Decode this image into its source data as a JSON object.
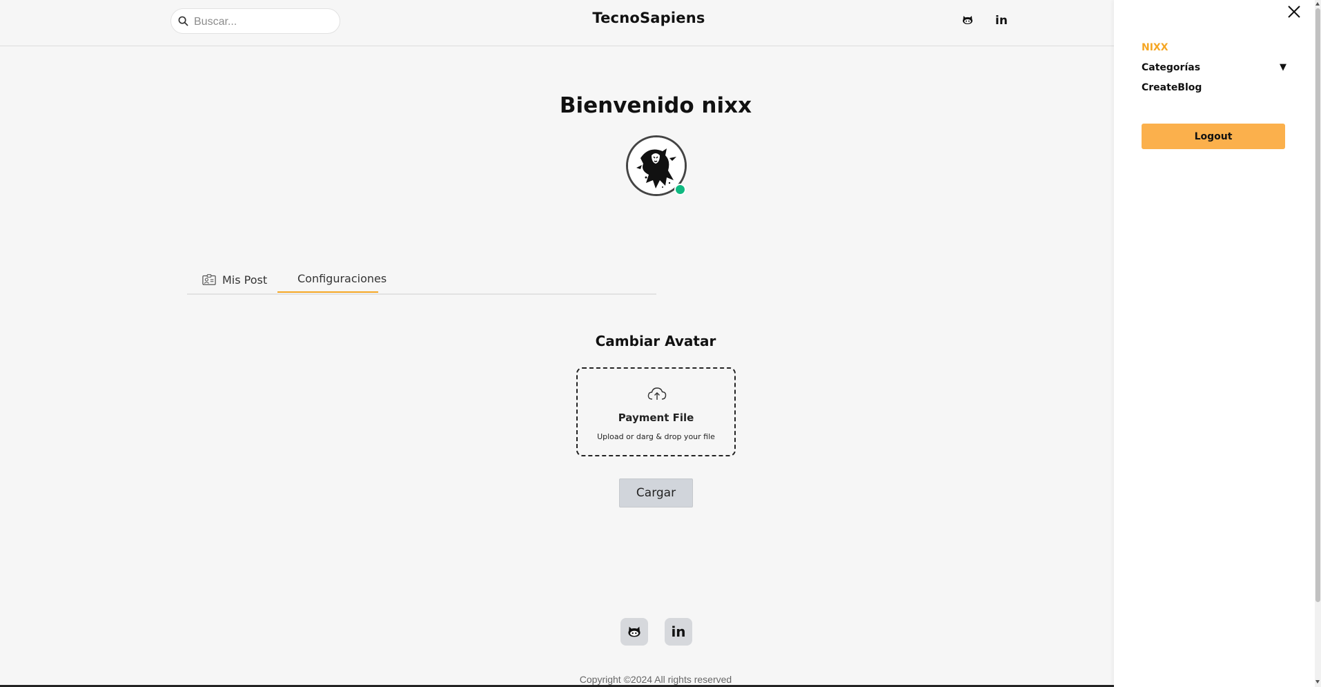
{
  "header": {
    "search_placeholder": "Buscar...",
    "brand": "TecnoSapiens",
    "linkedin_label": "in"
  },
  "main": {
    "welcome": "Bienvenido nixx",
    "tabs": [
      {
        "label": "Mis Post",
        "icon": "id-card-icon",
        "active": false
      },
      {
        "label": "Configuraciones",
        "icon": "gear-icon",
        "active": true
      }
    ],
    "section_title": "Cambiar Avatar",
    "dropzone": {
      "title": "Payment File",
      "subtitle": "Upload or darg & drop your file",
      "icon": "cloud-upload-icon"
    },
    "upload_button": "Cargar"
  },
  "footer": {
    "copyright": "Copyright ©2024 All rights reserved",
    "icons": [
      "github-icon",
      "linkedin-icon"
    ]
  },
  "drawer": {
    "user": "NIXX",
    "categories": "Categorías",
    "create_blog": "CreateBlog",
    "logout": "Logout"
  },
  "colors": {
    "accent": "#f5a623",
    "logout_bg": "#fbb04c",
    "online": "#10b981",
    "background": "#f6f6f6"
  }
}
